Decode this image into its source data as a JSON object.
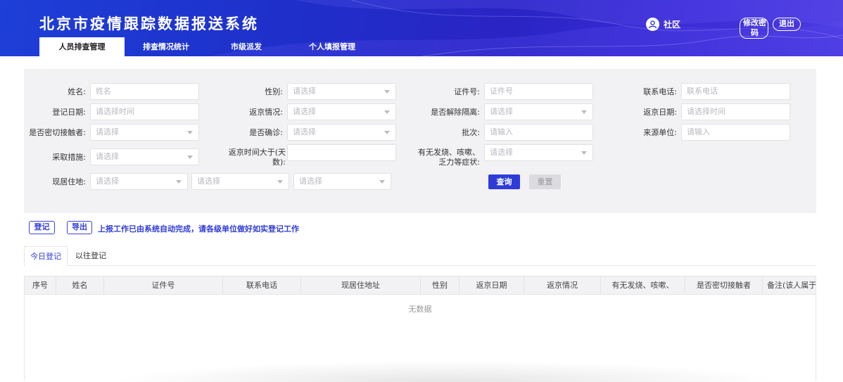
{
  "header": {
    "title": "北京市疫情跟踪数据报送系统",
    "user_name": "社区",
    "change_password": "修改密码",
    "logout": "退出",
    "bg_color": "#1f2fc9"
  },
  "nav": {
    "items": [
      {
        "label": "人员排查管理",
        "active": true
      },
      {
        "label": "排查情况统计",
        "active": false
      },
      {
        "label": "市级派发",
        "active": false
      },
      {
        "label": "个人填报管理",
        "active": false
      }
    ]
  },
  "filters": {
    "name_label": "姓名:",
    "name_placeholder": "姓名",
    "gender_label": "性别:",
    "gender_placeholder": "请选择",
    "id_label": "证件号:",
    "id_placeholder": "证件号",
    "phone_label": "联系电话:",
    "phone_placeholder": "联系电话",
    "reg_date_label": "登记日期:",
    "reg_date_placeholder": "请选择时间",
    "return_status_label": "返京情况:",
    "return_status_placeholder": "请选择",
    "released_label": "是否解除隔离:",
    "released_placeholder": "请选择",
    "return_date_label": "返京日期:",
    "return_date_placeholder": "请选择时间",
    "contact_label": "是否密切接触者:",
    "contact_placeholder": "请选择",
    "confirmed_label": "是否确诊:",
    "confirmed_placeholder": "请选择",
    "batch_label": "批次:",
    "batch_placeholder": "请输入",
    "source_label": "来源单位:",
    "source_placeholder": "请输入",
    "measures_label": "采取措施:",
    "measures_placeholder": "请选择",
    "days_label": "返京时间大于(天数):",
    "days_value": "",
    "symptoms_label": "有无发烧、咳嗽、乏力等症状:",
    "symptoms_placeholder": "请选择",
    "address_label": "现居住地:",
    "address_placeholders": [
      "请选择",
      "请选择",
      "请选择"
    ],
    "query_button": "查询",
    "reset_button": "重置"
  },
  "actions": {
    "register_button": "登记",
    "export_button": "导出",
    "notice": "上报工作已由系统自动完成，请各级单位做好如实登记工作"
  },
  "tabs": [
    {
      "label": "今日登记",
      "active": true
    },
    {
      "label": "以往登记",
      "active": false
    }
  ],
  "table": {
    "columns": [
      "序号",
      "姓名",
      "证件号",
      "联系电话",
      "现居住地址",
      "性别",
      "返京日期",
      "返京情况",
      "有无发烧、咳嗽、",
      "是否密切接触者",
      "备注(该人属于"
    ],
    "empty_text": "无数据"
  },
  "colors": {
    "accent": "#2f3bd9",
    "panel_bg": "#f2f2f4"
  }
}
